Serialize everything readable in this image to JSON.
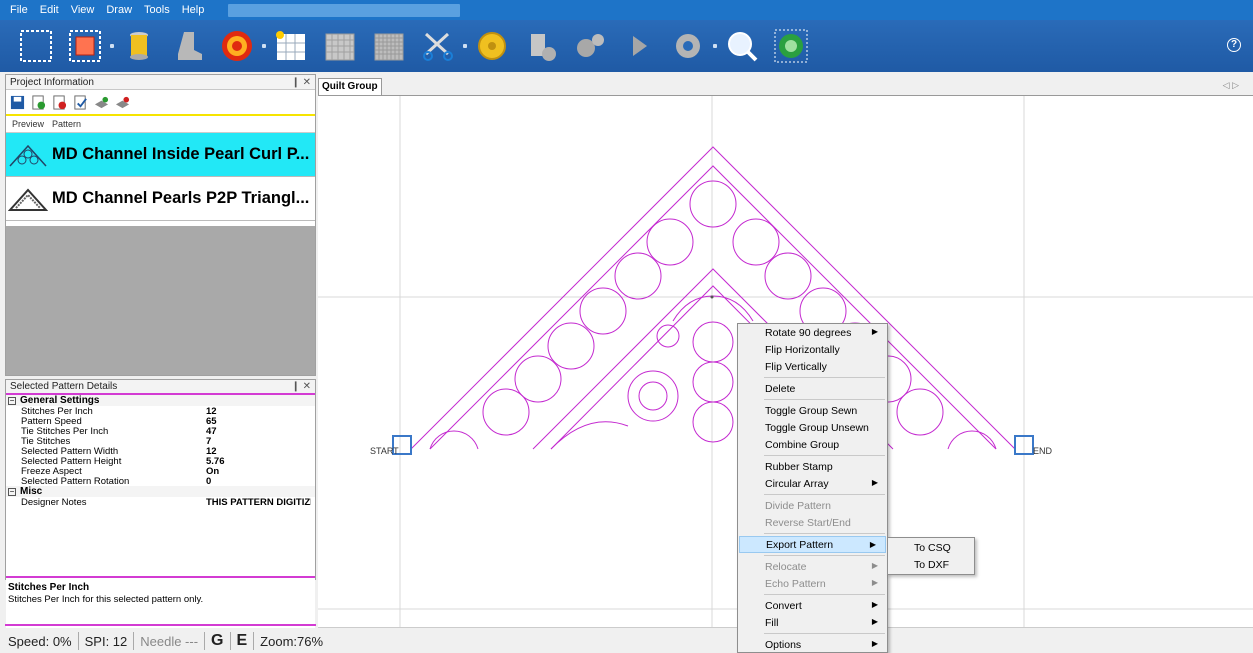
{
  "menu": [
    "File",
    "Edit",
    "View",
    "Draw",
    "Tools",
    "Help"
  ],
  "toolbar": {
    "help_label": "?",
    "icons": [
      "select-rect-icon",
      "select-fill-icon",
      "thread-spool-icon",
      "boot-icon",
      "target-icon",
      "grid-sparkle-icon",
      "grid-icon",
      "grid-dense-icon",
      "scissors-icon",
      "measure-tape-icon",
      "thread-gear-icon",
      "gears-icon",
      "play-icon",
      "gear-icon",
      "globe-search-icon",
      "globe-refresh-icon"
    ]
  },
  "project_panel": {
    "title": "Project Information",
    "pin": "❙ ✕",
    "tabs": [
      "Preview",
      "Pattern"
    ],
    "patterns": [
      {
        "name": "MD Channel Inside Pearl Curl P...",
        "selected": true
      },
      {
        "name": "MD Channel Pearls P2P Triangl...",
        "selected": false
      }
    ]
  },
  "details_panel": {
    "title": "Selected Pattern Details",
    "pin": "❙ ✕",
    "general": {
      "label": "General Settings",
      "rows": [
        {
          "k": "Stitches Per Inch",
          "v": "12"
        },
        {
          "k": "Pattern Speed",
          "v": "65"
        },
        {
          "k": "Tie Stitches Per Inch",
          "v": "47"
        },
        {
          "k": "Tie Stitches",
          "v": "7"
        },
        {
          "k": "Selected Pattern Width",
          "v": "12"
        },
        {
          "k": "Selected Pattern Height",
          "v": "5.76"
        },
        {
          "k": "Freeze Aspect",
          "v": "On"
        },
        {
          "k": "Selected Pattern Rotation",
          "v": "0"
        }
      ]
    },
    "misc": {
      "label": "Misc",
      "rows": [
        {
          "k": "Designer Notes",
          "v": "THIS PATTERN DIGITIZED"
        }
      ]
    },
    "desc_title": "Stitches Per Inch",
    "desc_text": "Stitches Per Inch for this selected pattern only."
  },
  "status": {
    "speed": "Speed: 0%",
    "spi": "SPI: 12",
    "needle": "Needle ---",
    "g": "G",
    "e": "E",
    "zoom": "Zoom:76%"
  },
  "canvas": {
    "tab": "Quilt Group",
    "tab_arrows": "◁ ▷",
    "start_label": "START",
    "end_label": "END",
    "stroke_color": "#c42ad0"
  },
  "context_menu": [
    {
      "label": "Rotate 90 degrees",
      "sub": true
    },
    {
      "label": "Flip Horizontally"
    },
    {
      "label": "Flip Vertically"
    },
    {
      "sep": true
    },
    {
      "label": "Delete"
    },
    {
      "sep": true
    },
    {
      "label": "Toggle Group Sewn"
    },
    {
      "label": "Toggle Group Unsewn"
    },
    {
      "label": "Combine Group"
    },
    {
      "sep": true
    },
    {
      "label": "Rubber Stamp"
    },
    {
      "label": "Circular Array",
      "sub": true
    },
    {
      "sep": true
    },
    {
      "label": "Divide Pattern",
      "disabled": true
    },
    {
      "label": "Reverse Start/End",
      "disabled": true
    },
    {
      "sep": true
    },
    {
      "label": "Export Pattern",
      "sub": true,
      "highlight": true
    },
    {
      "sep": true
    },
    {
      "label": "Relocate",
      "sub": true,
      "disabled": true
    },
    {
      "label": "Echo Pattern",
      "sub": true,
      "disabled": true
    },
    {
      "sep": true
    },
    {
      "label": "Convert",
      "sub": true
    },
    {
      "label": "Fill",
      "sub": true
    },
    {
      "sep": true
    },
    {
      "label": "Options",
      "sub": true
    }
  ],
  "submenu": [
    "To CSQ",
    "To DXF"
  ]
}
